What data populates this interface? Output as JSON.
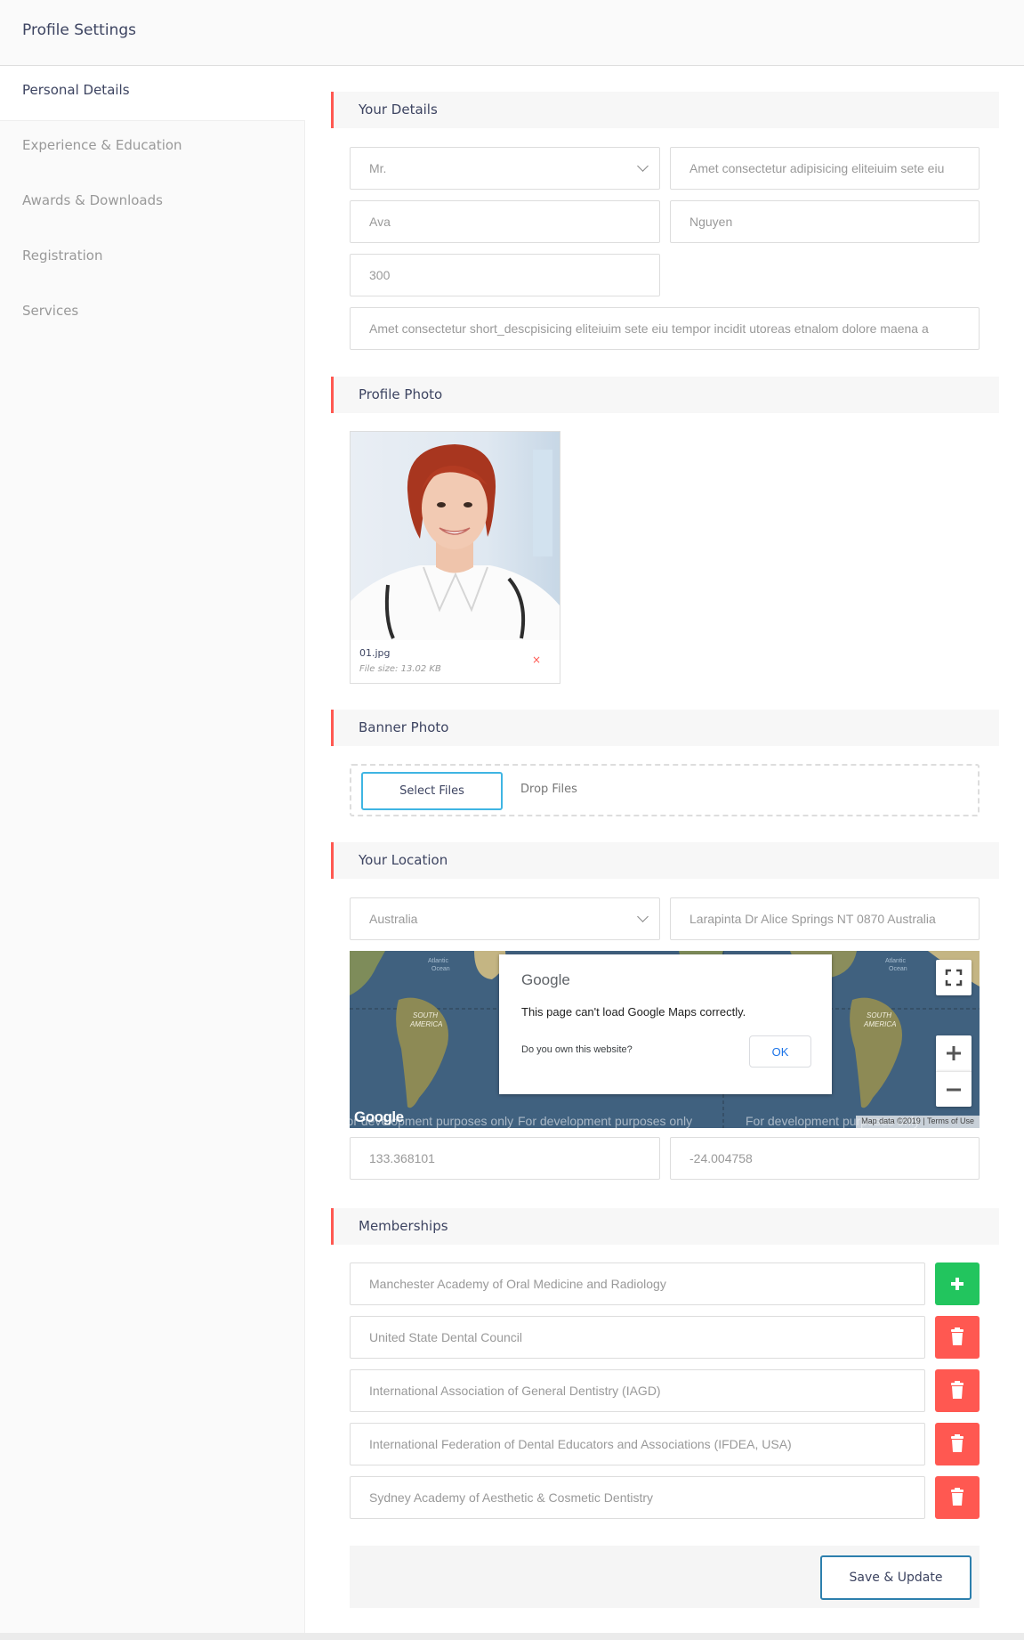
{
  "header": {
    "title": "Profile Settings"
  },
  "sidebar": {
    "items": [
      {
        "label": "Personal Details",
        "active": true
      },
      {
        "label": "Experience & Education"
      },
      {
        "label": "Awards & Downloads"
      },
      {
        "label": "Registration"
      },
      {
        "label": "Services"
      }
    ]
  },
  "sections": {
    "details": "Your Details",
    "photo": "Profile Photo",
    "banner": "Banner Photo",
    "location": "Your Location",
    "memberships": "Memberships"
  },
  "details": {
    "salutation": "Mr.",
    "tagline": "Amet consectetur adipisicing eliteiuim sete eiu",
    "first_name": "Ava",
    "last_name": "Nguyen",
    "rate": "300",
    "description": "Amet consectetur short_descpisicing eliteiuim sete eiu tempor incidit utoreas etnalom dolore maena a"
  },
  "photo": {
    "file_name": "01.jpg",
    "file_size": "File size: 13.02 KB",
    "remove": "×"
  },
  "banner": {
    "select_label": "Select Files",
    "drop_label": "Drop Files"
  },
  "location": {
    "country": "Australia",
    "address": "Larapinta Dr Alice Springs NT 0870 Australia",
    "longitude": "133.368101",
    "latitude": "-24.004758",
    "map": {
      "dialog_logo": "Google",
      "dialog_message": "This page can't load Google Maps correctly.",
      "dialog_question": "Do you own this website?",
      "ok_label": "OK",
      "dev_notice": "For development purposes only",
      "attribution": "Map data ©2019  |  Terms of Use",
      "watermark": "Google"
    }
  },
  "memberships": [
    "Manchester Academy of Oral Medicine and Radiology",
    "United State Dental Council",
    "International Association of General Dentistry (IAGD)",
    "International Federation of Dental Educators and Associations (IFDEA, USA)",
    "Sydney Academy of Aesthetic & Cosmetic Dentistry"
  ],
  "actions": {
    "save_label": "Save & Update"
  },
  "colors": {
    "accent": "#ff5851",
    "add": "#22c55e",
    "select_border": "#3fb5e3",
    "save_border": "#2d7fad"
  }
}
